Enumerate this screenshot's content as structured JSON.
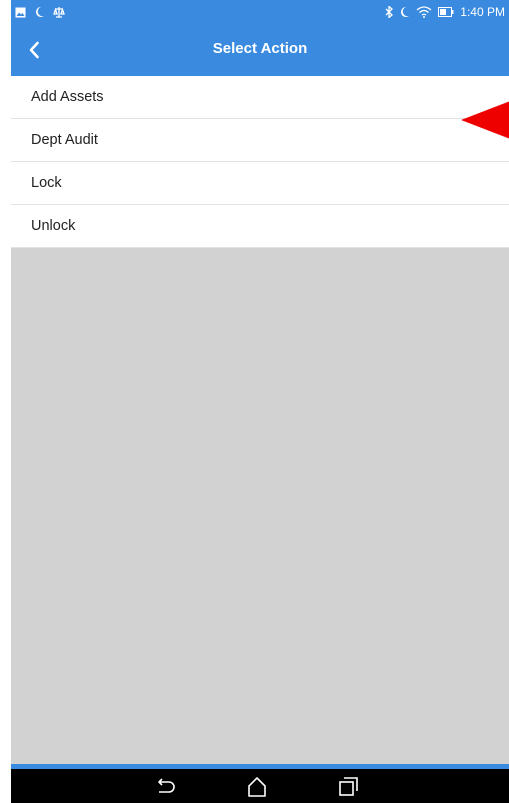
{
  "status_bar": {
    "time": "1:40 PM",
    "left_icons": [
      "gallery-icon",
      "moon-icon",
      "scale-icon"
    ],
    "right_icons": [
      "bluetooth-icon",
      "moon-icon",
      "wifi-icon",
      "battery-icon"
    ]
  },
  "header": {
    "title": "Select Action",
    "back_icon": "chevron-left-icon"
  },
  "actions": {
    "items": [
      {
        "label": "Add Assets"
      },
      {
        "label": "Dept Audit"
      },
      {
        "label": "Lock"
      },
      {
        "label": "Unlock"
      }
    ]
  },
  "annotation": {
    "color": "#ee0000",
    "shape": "left-pointing arrow",
    "points_to": "Dept Audit"
  },
  "nav_bar": {
    "icons": [
      "back-icon",
      "home-icon",
      "recents-icon"
    ]
  },
  "colors": {
    "accent": "#3a8be0",
    "background": "#d3d2d3",
    "nav": "#000000"
  }
}
